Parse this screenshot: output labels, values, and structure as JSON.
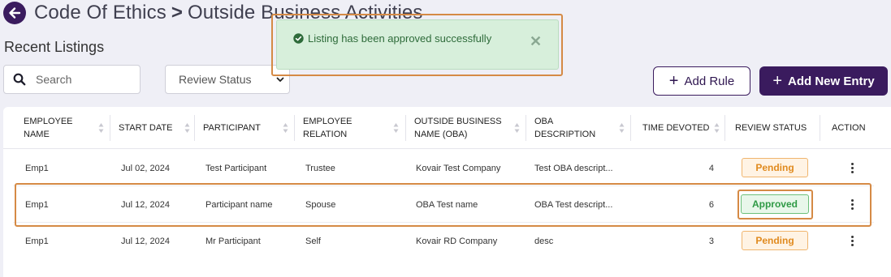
{
  "header": {
    "crumb_parent": "Code Of Ethics",
    "separator": ">",
    "crumb_current": "Outside Business Activities"
  },
  "subtitle": "Recent Listings",
  "search": {
    "placeholder": "Search"
  },
  "filter": {
    "selected": "Review Status"
  },
  "buttons": {
    "add_rule": "Add Rule",
    "add_entry": "Add New Entry"
  },
  "toast": {
    "message": "Listing has been approved successfully",
    "close": "✕"
  },
  "columns": [
    {
      "line1": "EMPLOYEE",
      "line2": "NAME"
    },
    {
      "line1": "START DATE",
      "line2": ""
    },
    {
      "line1": "PARTICIPANT",
      "line2": ""
    },
    {
      "line1": "EMPLOYEE",
      "line2": "RELATION"
    },
    {
      "line1": "OUTSIDE BUSINESS",
      "line2": "NAME (OBA)"
    },
    {
      "line1": "OBA",
      "line2": "DESCRIPTION"
    },
    {
      "line1": "TIME DEVOTED",
      "line2": ""
    },
    {
      "line1": "REVIEW STATUS",
      "line2": ""
    },
    {
      "line1": "ACTION",
      "line2": ""
    }
  ],
  "rows": [
    {
      "employee": "Emp1",
      "start_date": "Jul 02, 2024",
      "participant": "Test Participant",
      "relation": "Trustee",
      "business": "Kovair Test Company",
      "description": "Test OBA descript...",
      "time": "4",
      "status": "Pending"
    },
    {
      "employee": "Emp1",
      "start_date": "Jul 12, 2024",
      "participant": "Participant name",
      "relation": "Spouse",
      "business": "OBA Test name",
      "description": "OBA Test descript...",
      "time": "6",
      "status": "Approved"
    },
    {
      "employee": "Emp1",
      "start_date": "Jul 12, 2024",
      "participant": "Mr Participant",
      "relation": "Self",
      "business": "Kovair RD Company",
      "description": "desc",
      "time": "3",
      "status": "Pending"
    }
  ],
  "colors": {
    "primary": "#3a1b5e",
    "pending": "#e08a1e",
    "approved": "#2f9a45",
    "highlight": "#d58a45",
    "toast_bg": "#d7efdb"
  }
}
